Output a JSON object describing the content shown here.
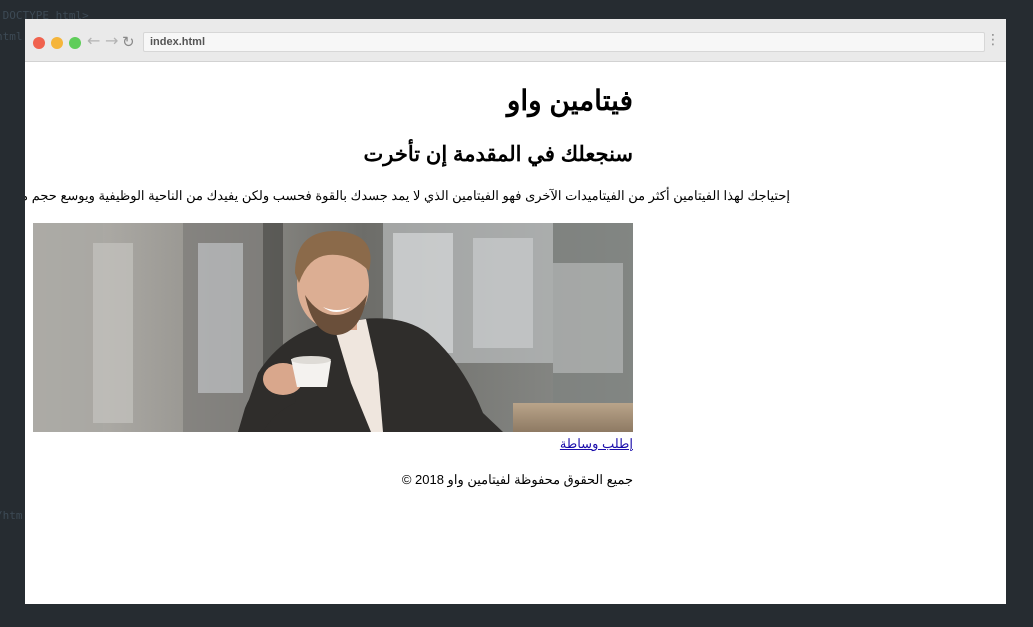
{
  "editor": {
    "line_1": "!DOCTYPE html>",
    "line_2": "html",
    "line_3": "/htm"
  },
  "browser": {
    "address": "index.html",
    "back_glyph": "←",
    "forward_glyph": "→",
    "reload_glyph": "↻",
    "menu_glyph": "⋮"
  },
  "page": {
    "title": "فيتامين واو",
    "subtitle": "سنجعلك في المقدمة إن تأخرت",
    "lead": "إحتياجك لهذا الفيتامين أكثر من الفيتاميدات الآخرى فهو الفيتامين الذي لا يمد جسدك بالقوة فحسب ولكن يفيدك من الناحية الوظيفية ويوسع حجم معارفك.",
    "image_alt": "Smiling man in a blazer holding a coffee cup",
    "cta_link": "إطلب وساطة",
    "copyright": "جميع الحقوق محفوظة لفيتامين واو 2018 ©"
  },
  "colors": {
    "desktop_bg": "#262c31",
    "titlebar_bg": "#eaeaea",
    "close": "#f0624e",
    "minimize": "#f5b53b",
    "maximize": "#5fcd5a",
    "link": "#1a0dab"
  }
}
